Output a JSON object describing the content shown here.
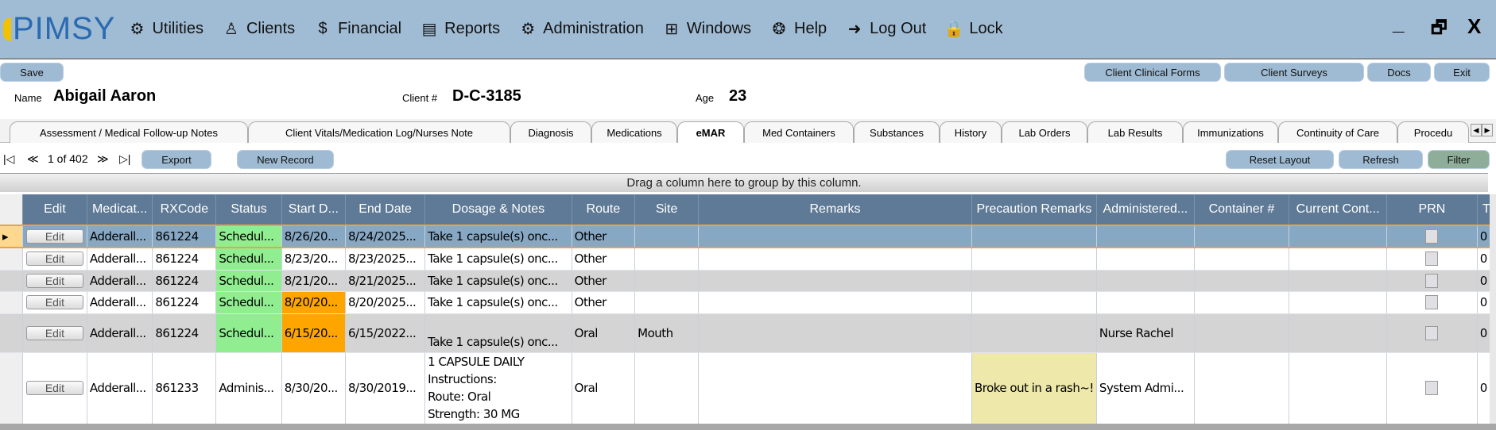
{
  "app": {
    "logo": "PIMSY"
  },
  "menu": [
    {
      "label": "Utilities",
      "icon": "gear-icon"
    },
    {
      "label": "Clients",
      "icon": "person-icon"
    },
    {
      "label": "Financial",
      "icon": "money-hand-icon"
    },
    {
      "label": "Reports",
      "icon": "report-icon"
    },
    {
      "label": "Administration",
      "icon": "admin-icon"
    },
    {
      "label": "Windows",
      "icon": "windows-grid-icon"
    },
    {
      "label": "Help",
      "icon": "lifebuoy-icon"
    },
    {
      "label": "Log Out",
      "icon": "logout-icon"
    },
    {
      "label": "Lock",
      "icon": "lock-icon"
    }
  ],
  "window": {
    "minimize": "_",
    "restore": "🗗",
    "close": "X"
  },
  "toolbar": {
    "save": "Save",
    "clinical_forms": "Client Clinical Forms",
    "surveys": "Client Surveys",
    "docs": "Docs",
    "exit": "Exit"
  },
  "client": {
    "name_label": "Name",
    "name": "Abigail Aaron",
    "id_label": "Client #",
    "id": "D-C-3185",
    "age_label": "Age",
    "age": "23"
  },
  "tabs": [
    "Assessment / Medical Follow-up Notes",
    "Client Vitals/Medication Log/Nurses Note",
    "Diagnosis",
    "Medications",
    "eMAR",
    "Med Containers",
    "Substances",
    "History",
    "Lab Orders",
    "Lab Results",
    "Immunizations",
    "Continuity of Care",
    "Procedu"
  ],
  "active_tab": "eMAR",
  "pager": {
    "text": "1 of 402",
    "export": "Export",
    "new_record": "New Record",
    "reset_layout": "Reset Layout",
    "refresh": "Refresh",
    "filter": "Filter"
  },
  "grid": {
    "group_hint": "Drag a column here to group by this column.",
    "columns": [
      "Edit",
      "Medicat...",
      "RXCode",
      "Status",
      "Start D...",
      "End Date",
      "Dosage & Notes",
      "Route",
      "Site",
      "Remarks",
      "Precaution Remarks",
      "Administered...",
      "Container #",
      "Current Cont...",
      "PRN",
      "T"
    ],
    "rows": [
      {
        "edit": "Edit",
        "med": "Adderall...",
        "rx": "861224",
        "status": "Schedul...",
        "start": "8/26/20...",
        "end": "8/24/2025...",
        "dosage": "Take 1 capsule(s) onc...",
        "route": "Other",
        "site": "",
        "remarks": "",
        "precaution": "",
        "admin": "",
        "container": "",
        "current": "",
        "prn": false,
        "t": "0"
      },
      {
        "edit": "Edit",
        "med": "Adderall...",
        "rx": "861224",
        "status": "Schedul...",
        "start": "8/23/20...",
        "end": "8/23/2025...",
        "dosage": "Take 1 capsule(s) onc...",
        "route": "Other",
        "site": "",
        "remarks": "",
        "precaution": "",
        "admin": "",
        "container": "",
        "current": "",
        "prn": false,
        "t": "0"
      },
      {
        "edit": "Edit",
        "med": "Adderall...",
        "rx": "861224",
        "status": "Schedul...",
        "start": "8/21/20...",
        "end": "8/21/2025...",
        "dosage": "Take 1 capsule(s) onc...",
        "route": "Other",
        "site": "",
        "remarks": "",
        "precaution": "",
        "admin": "",
        "container": "",
        "current": "",
        "prn": false,
        "t": "0"
      },
      {
        "edit": "Edit",
        "med": "Adderall...",
        "rx": "861224",
        "status": "Schedul...",
        "start": "8/20/20...",
        "end": "8/20/2025...",
        "dosage": "Take 1 capsule(s) onc...",
        "route": "Other",
        "site": "",
        "remarks": "",
        "precaution": "",
        "admin": "",
        "container": "",
        "current": "",
        "prn": false,
        "t": "0"
      },
      {
        "edit": "Edit",
        "med": "Adderall...",
        "rx": "861224",
        "status": "Schedul...",
        "start": "6/15/20...",
        "end": "6/15/2022...",
        "dosage": "Take 1 capsule(s) onc...",
        "route": "Oral",
        "site": "Mouth",
        "remarks": "",
        "precaution": "",
        "admin": "Nurse Rachel",
        "container": "",
        "current": "",
        "prn": false,
        "t": "0"
      },
      {
        "edit": "Edit",
        "med": "Adderall...",
        "rx": "861233",
        "status": "Adminis...",
        "start": "8/30/20...",
        "end": "8/30/2019...",
        "dosage": "1 CAPSULE DAILY\nInstructions:\nRoute:  Oral\nStrength:  30 MG",
        "route": "Oral",
        "site": "",
        "remarks": "",
        "precaution": "Broke out in a rash~!",
        "admin": "System  Admi...",
        "container": "",
        "current": "",
        "prn": false,
        "t": "0"
      }
    ]
  },
  "colors": {
    "topbar": "#a0bcd4",
    "header": "#5f7a96",
    "selected": "#87a8c4",
    "scheduled": "#90ee90",
    "late": "#ffa500",
    "precaution": "#eee8aa"
  }
}
